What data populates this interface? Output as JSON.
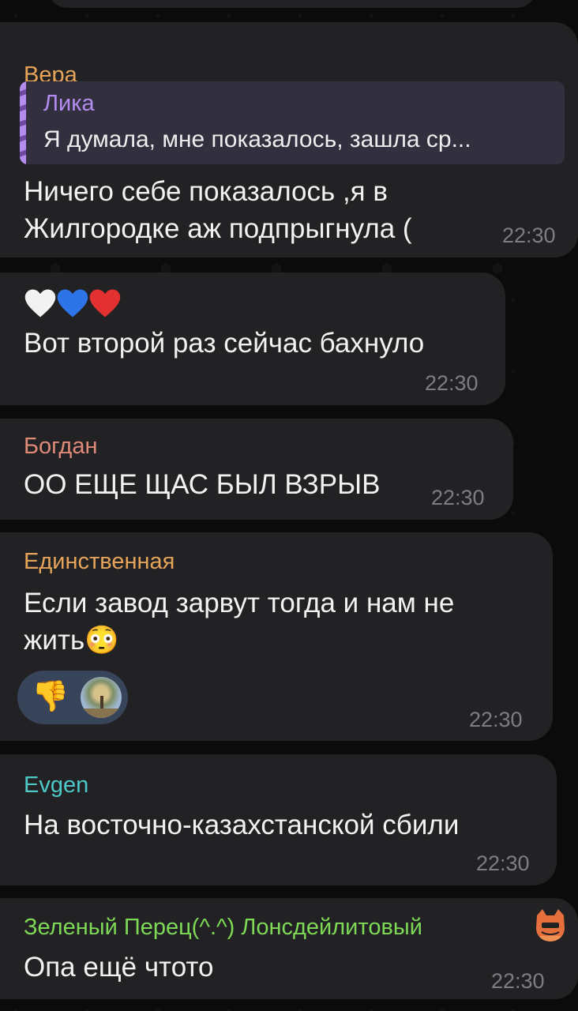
{
  "messages": [
    {
      "sender": "Вера",
      "sender_color": "#e6a45b",
      "reply": {
        "name": "Лика",
        "text": "Я думала, мне показалось, зашла ср..."
      },
      "lines": [
        "Ничего себе показалось ,я в",
        "Жилгородке аж подпрыгнула ("
      ],
      "time": "22:30"
    },
    {
      "emoji": [
        "white-heart",
        "blue-heart",
        "red-heart"
      ],
      "text": "Вот второй раз сейчас бахнуло",
      "time": "22:30"
    },
    {
      "sender": "Богдан",
      "sender_color": "#e08a7a",
      "text": "ОО ЕЩЕ ЩАС БЫЛ ВЗРЫВ",
      "time": "22:30"
    },
    {
      "sender": "Единственная",
      "sender_color": "#e6a45b",
      "lines": [
        "Если завод зарвут тогда и нам не",
        "жить😳"
      ],
      "reaction": {
        "emoji": "👎",
        "reactor_icon": "tree-avatar-icon"
      },
      "time": "22:30"
    },
    {
      "sender": "Evgen",
      "sender_color": "#4ec9c8",
      "text": "На восточно-казахстанской сбили",
      "time": "22:30"
    },
    {
      "sender": "Зеленый Перец(^.^) Лонсдейлитовый",
      "sender_color": "#7ed957",
      "sender_badge_icon": "cat-emoji-icon",
      "text": "Опа ещё чтото",
      "time": "22:30"
    }
  ]
}
